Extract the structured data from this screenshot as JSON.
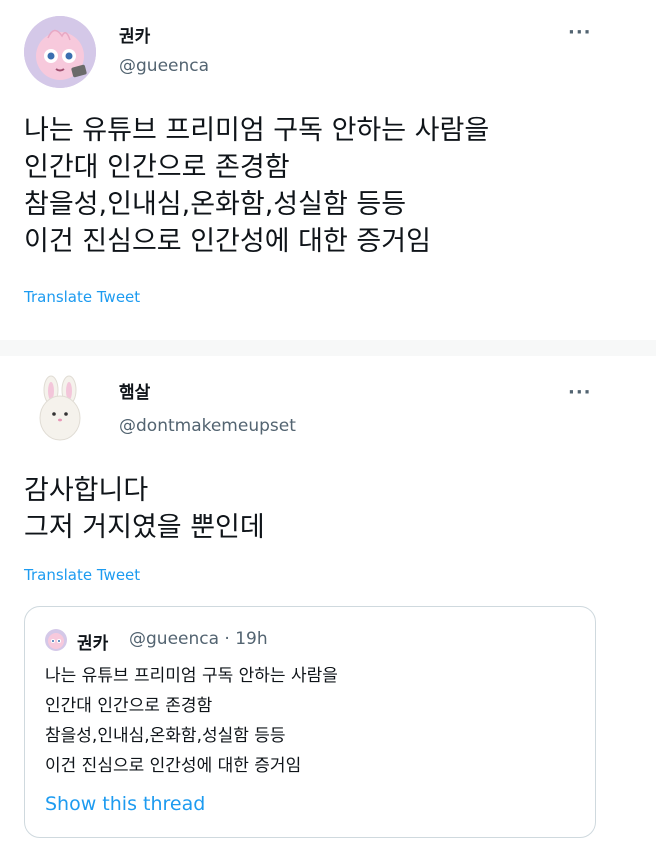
{
  "tweet1": {
    "name": "권카",
    "handle": "@gueenca",
    "more_icon": "···",
    "lines": [
      "나는 유튜브 프리미엄 구독 안하는 사람을",
      "인간대 인간으로 존경함",
      "참을성,인내심,온화함,성실함 등등",
      "이건 진심으로 인간성에 대한 증거임"
    ],
    "translate": "Translate Tweet"
  },
  "tweet2": {
    "name": "햄살",
    "handle": "@dontmakemeupset",
    "more_icon": "···",
    "lines": [
      "감사합니다",
      "그저 거지였을 뿐인데"
    ],
    "translate": "Translate Tweet"
  },
  "quote": {
    "name": "권카",
    "handle_time": "@gueenca · 19h",
    "lines": [
      "나는 유튜브 프리미엄 구독 안하는 사람을",
      "인간대 인간으로 존경함",
      "참을성,인내심,온화함,성실함 등등",
      "이건 진심으로 인간성에 대한 증거임"
    ],
    "show_thread": "Show this thread"
  },
  "colors": {
    "link": "#1d9bf0",
    "secondary": "#536471",
    "primary_text": "#0f1419",
    "avatar1_bg": "#d4c8e8",
    "avatar_pink": "#f3c6da"
  }
}
